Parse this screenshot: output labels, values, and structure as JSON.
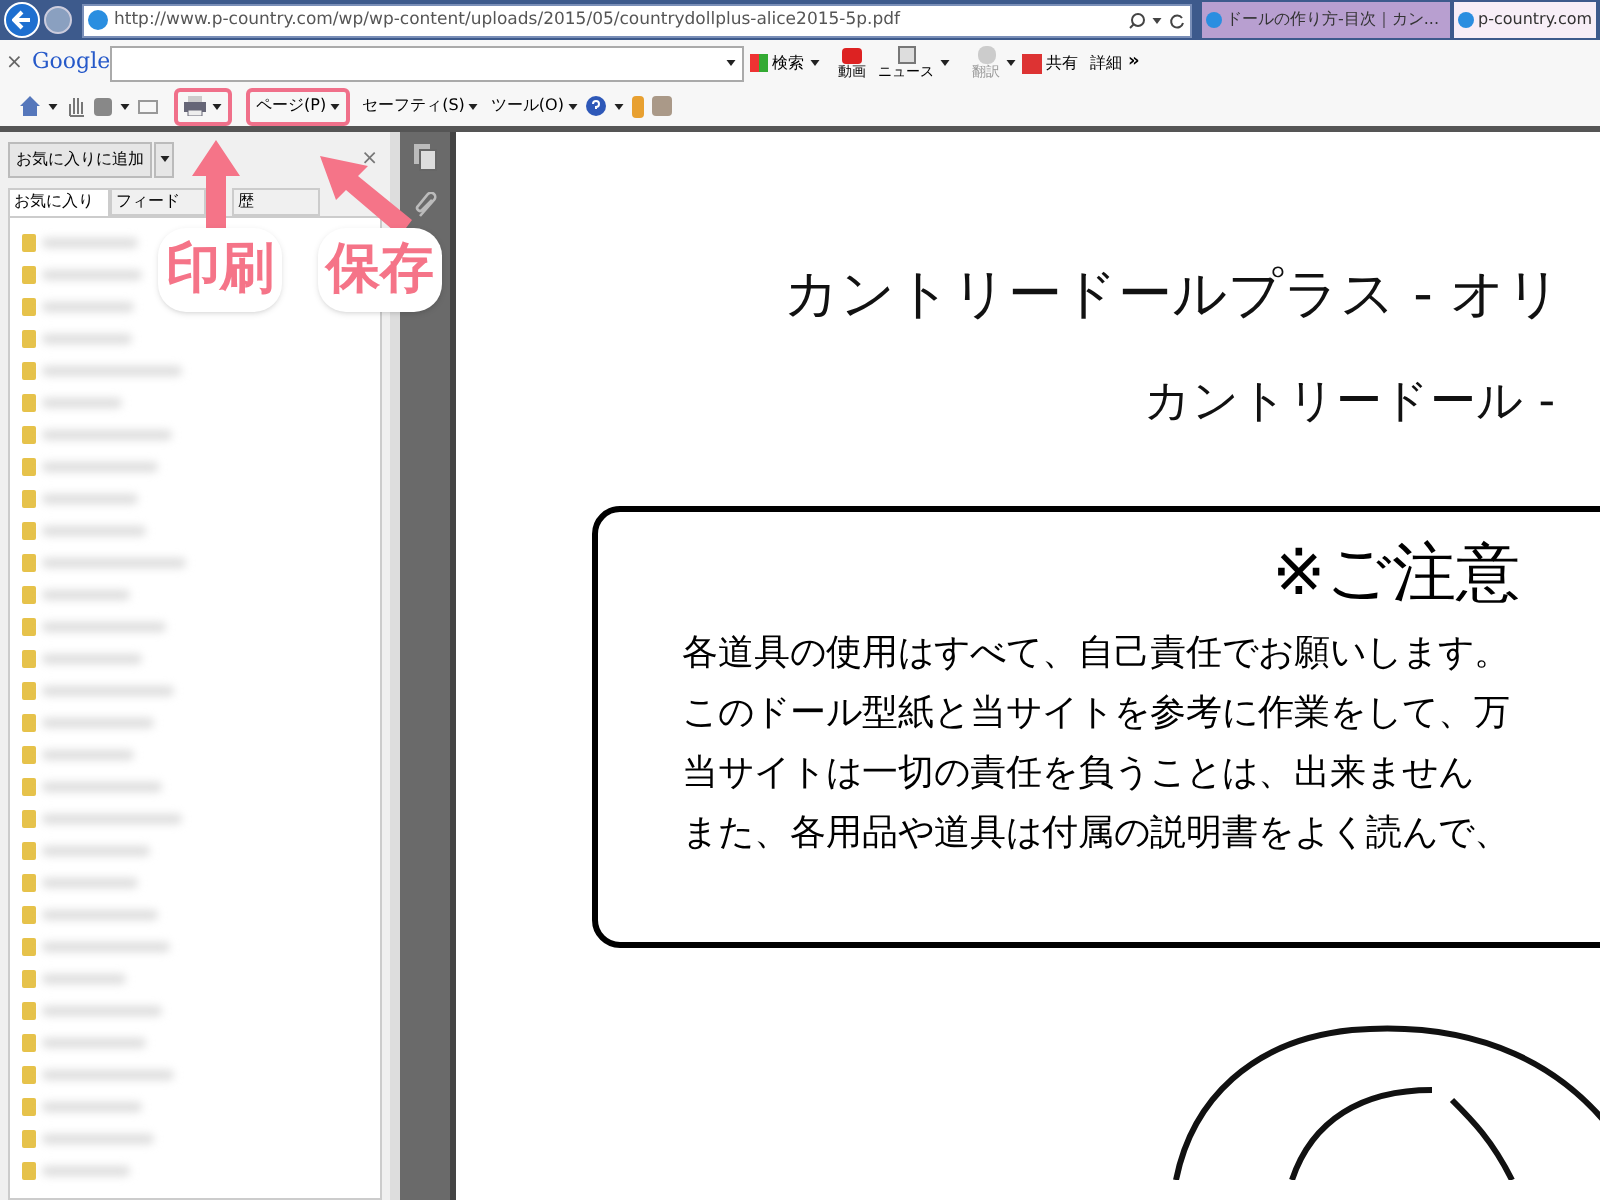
{
  "browser": {
    "address": "http://www.p-country.com/wp/wp-content/uploads/2015/05/countrydollplus-alice2015-5p.pdf",
    "tabs": [
      {
        "label": "ドールの作り方-目次｜カン...",
        "selected": false
      },
      {
        "label": "p-country.com",
        "selected": true
      }
    ]
  },
  "google_toolbar": {
    "close": "×",
    "logo": "Google",
    "search": "検索",
    "video": "動画",
    "news": "ニュース",
    "translate": "翻訳",
    "share": "共有",
    "details": "詳細",
    "more": "»"
  },
  "command_bar": {
    "page": "ページ(P)",
    "safety": "セーフティ(S)",
    "tools": "ツール(O)"
  },
  "sidebar": {
    "add_button": "お気に入りに追加",
    "close": "×",
    "tabs": [
      {
        "label": "お気に入り",
        "selected": true
      },
      {
        "label": "フィード",
        "selected": false
      },
      {
        "label": "歴",
        "selected": false
      }
    ],
    "favorites": [
      {
        "kind": "folder"
      },
      {
        "kind": "folder"
      },
      {
        "kind": "folder"
      },
      {
        "kind": "folder"
      },
      {
        "kind": "folder"
      },
      {
        "kind": "folder"
      },
      {
        "kind": "folder"
      },
      {
        "kind": "folder"
      },
      {
        "kind": "folder"
      },
      {
        "kind": "folder"
      },
      {
        "kind": "folder"
      },
      {
        "kind": "folder"
      },
      {
        "kind": "folder"
      },
      {
        "kind": "folder"
      },
      {
        "kind": "folder"
      },
      {
        "kind": "folder"
      },
      {
        "kind": "folder"
      },
      {
        "kind": "folder"
      },
      {
        "kind": "folder"
      },
      {
        "kind": "folder"
      },
      {
        "kind": "folder"
      },
      {
        "kind": "folder"
      },
      {
        "kind": "folder"
      },
      {
        "kind": "folder"
      },
      {
        "kind": "folder"
      },
      {
        "kind": "folder"
      },
      {
        "kind": "folder"
      },
      {
        "kind": "folder"
      },
      {
        "kind": "folder"
      },
      {
        "kind": "folder"
      }
    ]
  },
  "document": {
    "title": "カントリードールプラス - オリ",
    "subtitle": "カントリードール -",
    "notice": {
      "heading": "※ご注意",
      "lines": [
        "各道具の使用はすべて、自己責任でお願いします。",
        "このドール型紙と当サイトを参考に作業をして、万",
        "当サイトは一切の責任を負うことは、出来ません",
        "また、各用品や道具は付属の説明書をよく読んで、"
      ]
    }
  },
  "annotations": [
    {
      "label": "印刷"
    },
    {
      "label": "保存"
    }
  ]
}
